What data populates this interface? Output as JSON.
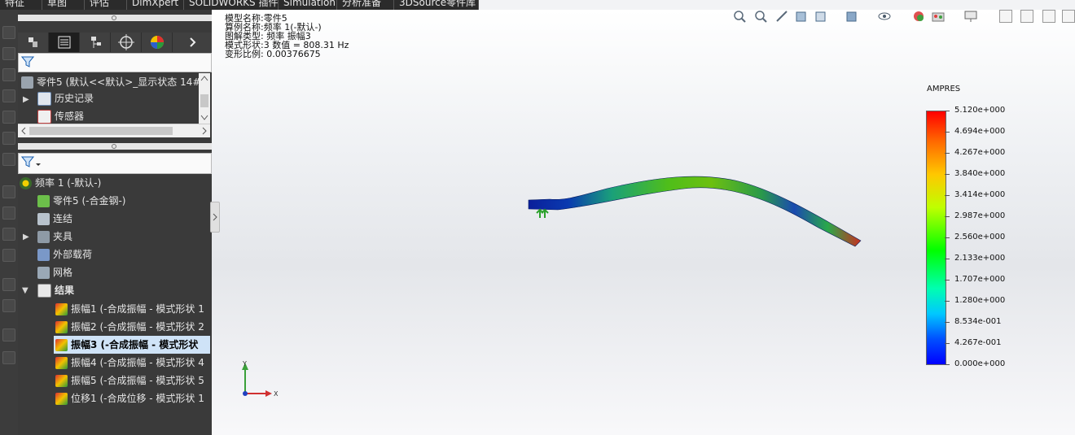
{
  "tabs": [
    "特征",
    "草图",
    "评估",
    "DimXpert",
    "SOLIDWORKS 插件",
    "Simulation",
    "分析准备",
    "3DSource零件库"
  ],
  "upper_tree": {
    "root_label": "零件5  (默认<<默认>_显示状态 14#",
    "items": [
      {
        "label": "历史记录",
        "icon": "history-icon"
      },
      {
        "label": "传感器",
        "icon": "sensor-icon"
      }
    ]
  },
  "study_tree": {
    "root_label": "频率 1 (-默认-)",
    "items": [
      {
        "label": "零件5 (-合金钢-)",
        "icon": "part-icon",
        "expand": false
      },
      {
        "label": "连结",
        "icon": "connection-icon",
        "expand": false
      },
      {
        "label": "夹具",
        "icon": "fixture-icon",
        "expand": true
      },
      {
        "label": "外部载荷",
        "icon": "load-icon",
        "expand": false
      },
      {
        "label": "网格",
        "icon": "mesh-icon",
        "expand": false
      },
      {
        "label": "结果",
        "icon": "results-folder-icon",
        "expand": true,
        "open": true
      }
    ],
    "results": [
      {
        "label": "振幅1 (-合成振幅 - 模式形状 1",
        "selected": false
      },
      {
        "label": "振幅2 (-合成振幅 - 模式形状 2",
        "selected": false
      },
      {
        "label": "振幅3 (-合成振幅 - 模式形状",
        "selected": true
      },
      {
        "label": "振幅4 (-合成振幅 - 模式形状 4",
        "selected": false
      },
      {
        "label": "振幅5 (-合成振幅 - 模式形状 5",
        "selected": false
      },
      {
        "label": "位移1 (-合成位移 - 模式形状 1",
        "selected": false
      }
    ]
  },
  "info": {
    "model_name": "模型名称:零件5",
    "study_name": "算例名称:频率 1(-默认-)",
    "plot_type": "图解类型: 频率 振幅3",
    "mode_shape": "模式形状:3  数值 =       808.31 Hz",
    "deform_scale": "变形比例: 0.00376675"
  },
  "legend": {
    "title": "AMPRES",
    "values": [
      "5.120e+000",
      "4.694e+000",
      "4.267e+000",
      "3.840e+000",
      "3.414e+000",
      "2.987e+000",
      "2.560e+000",
      "2.133e+000",
      "1.707e+000",
      "1.280e+000",
      "8.534e-001",
      "4.267e-001",
      "0.000e+000"
    ]
  },
  "triad": {
    "x": "X",
    "y": "Y"
  },
  "colors": {
    "panel": "#3a3a3a",
    "selected": "#cfe3f7",
    "accent": "#1e6fd9"
  }
}
